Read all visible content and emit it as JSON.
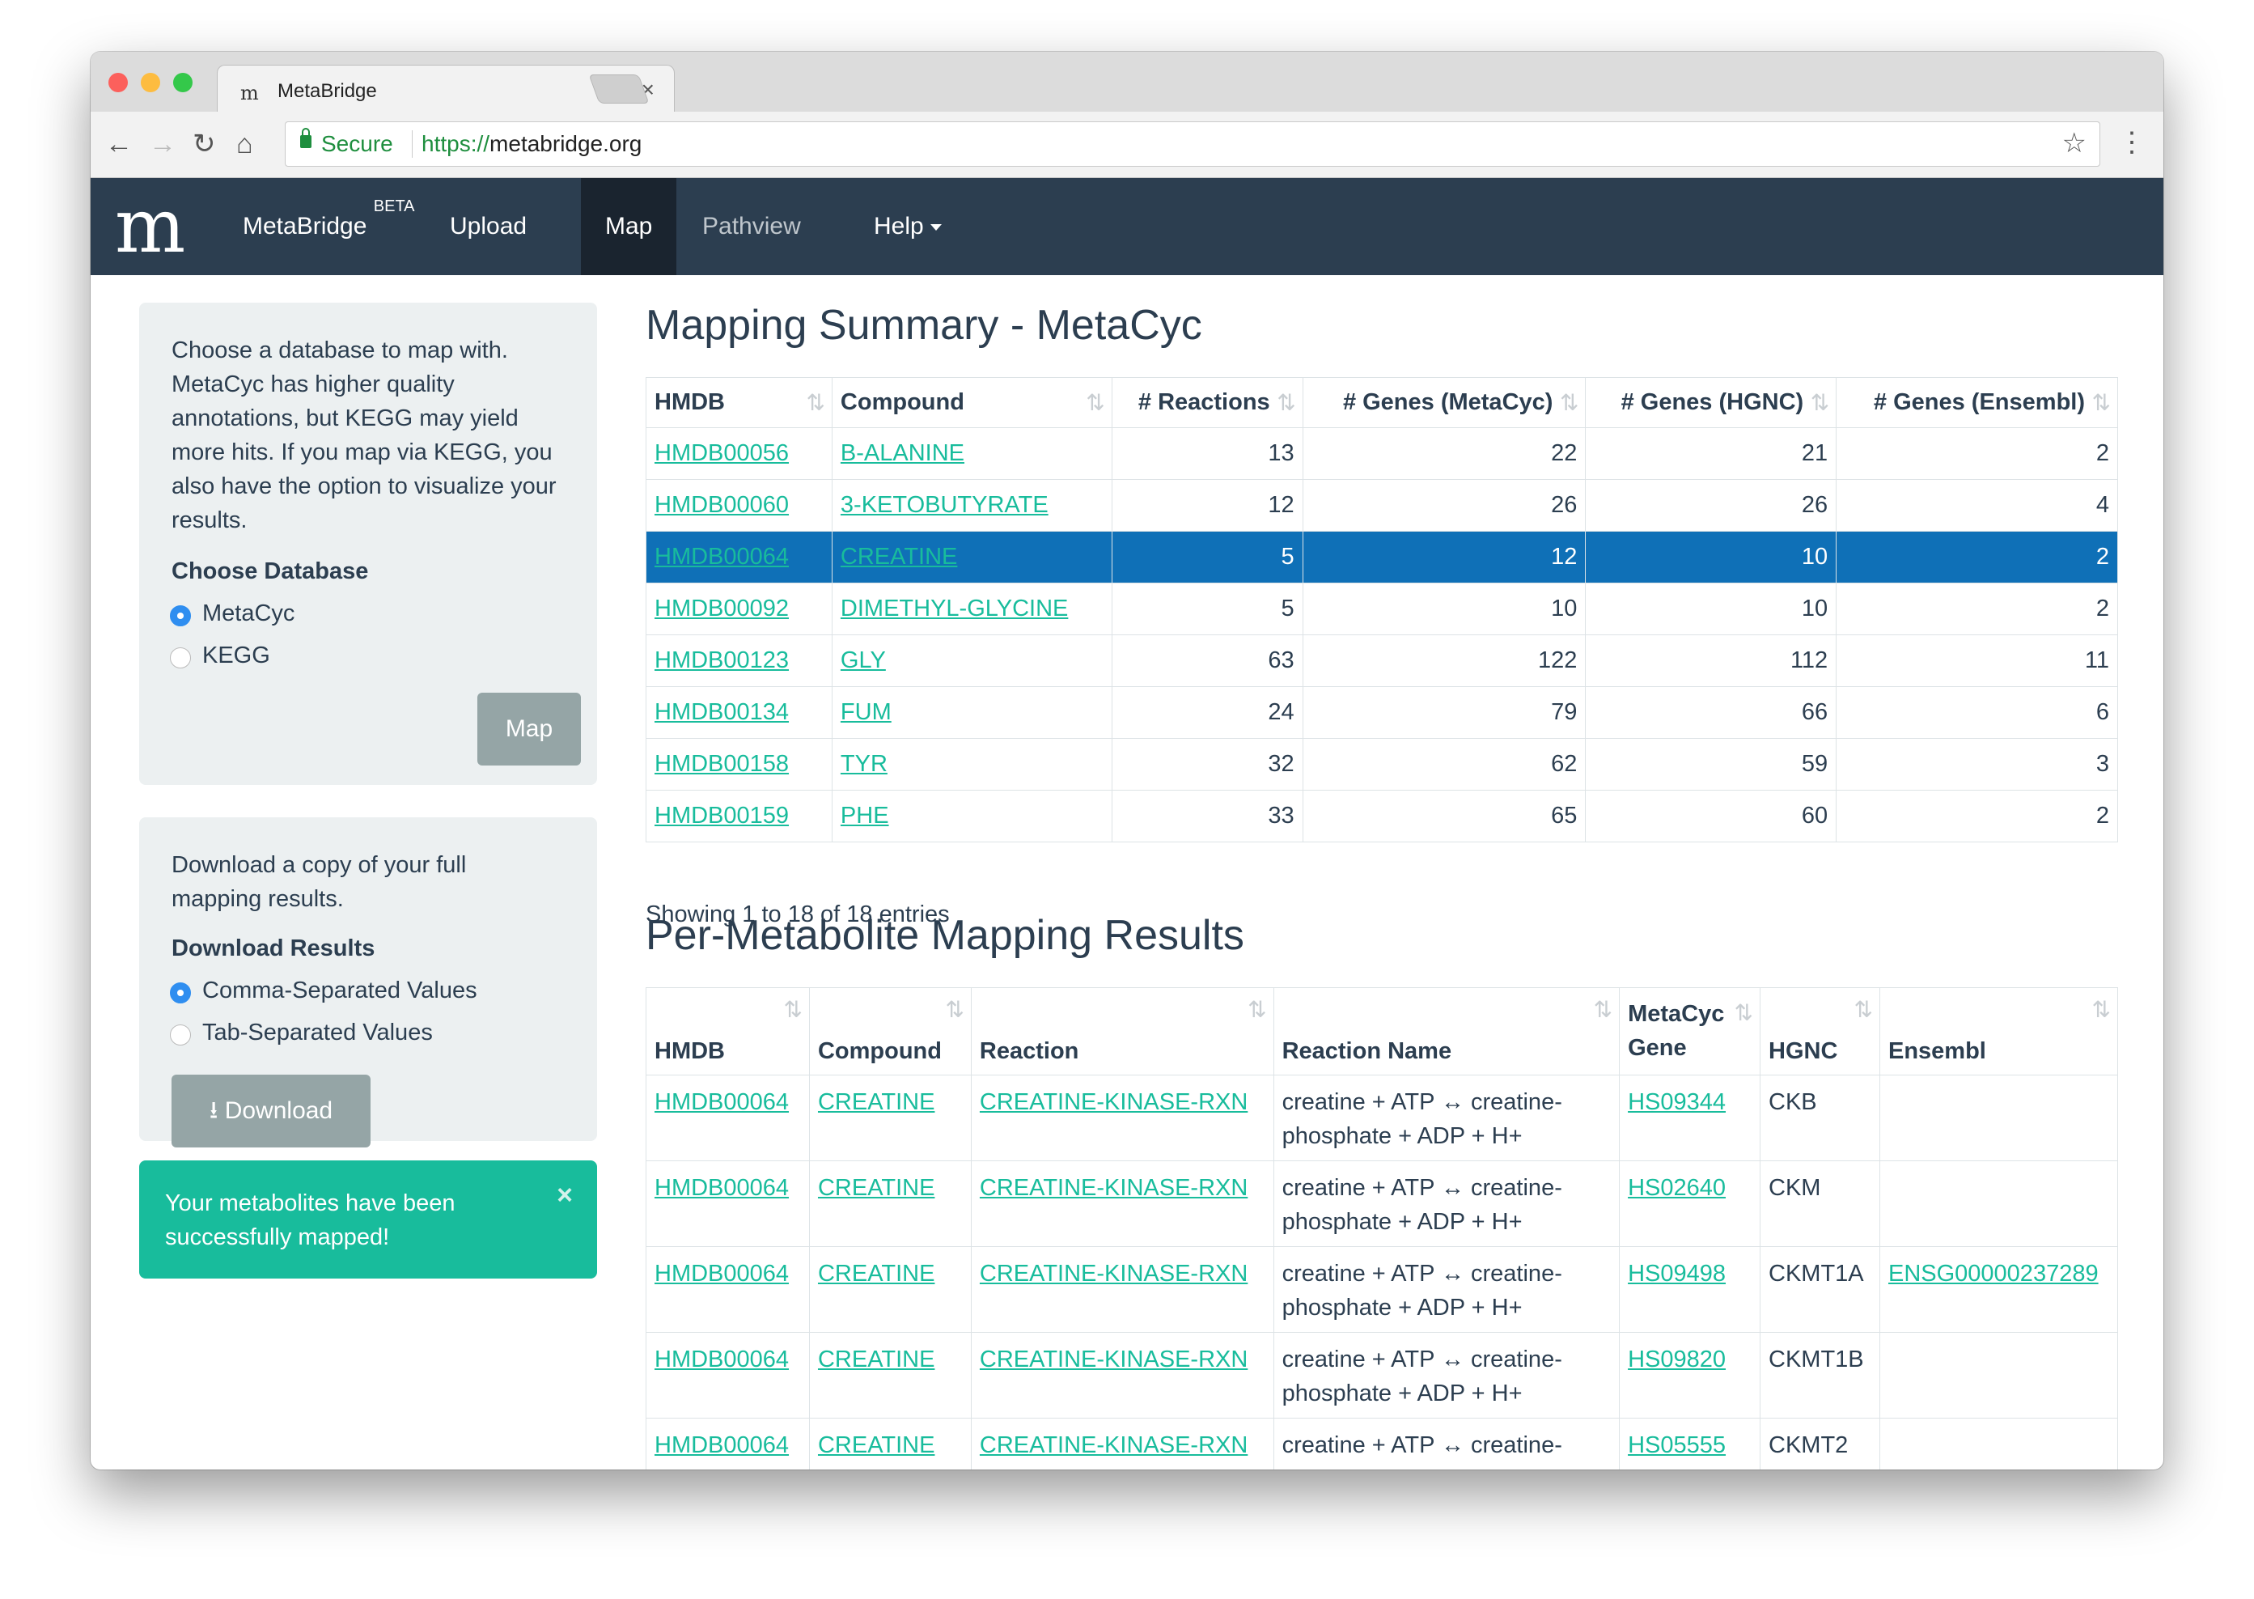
{
  "browser": {
    "tab_title": "MetaBridge",
    "tab_favicon": "m",
    "tab_close": "×",
    "secure_label": "Secure",
    "url_protocol": "https://",
    "url_host": "metabridge.org"
  },
  "navbar": {
    "logo": "m",
    "brand": "MetaBridge",
    "brand_badge": "BETA",
    "items": [
      "Upload",
      "Map",
      "Pathview",
      "Help"
    ],
    "active": "Map"
  },
  "sidebar": {
    "map_panel": {
      "description": "Choose a database to map with. MetaCyc has higher quality annotations, but KEGG may yield more hits. If you map via KEGG, you also have the option to visualize your results.",
      "label": "Choose Database",
      "options": [
        "MetaCyc",
        "KEGG"
      ],
      "selected": "MetaCyc",
      "button": "Map"
    },
    "download_panel": {
      "description": "Download a copy of your full mapping results.",
      "label": "Download Results",
      "options": [
        "Comma-Separated Values",
        "Tab-Separated Values"
      ],
      "selected": "Comma-Separated Values",
      "button": "Download"
    },
    "alert": {
      "message": "Your metabolites have been successfully mapped!",
      "close": "×"
    }
  },
  "summary": {
    "title": "Mapping Summary - MetaCyc",
    "columns": [
      "HMDB",
      "Compound",
      "# Reactions",
      "# Genes (MetaCyc)",
      "# Genes (HGNC)",
      "# Genes (Ensembl)"
    ],
    "rows": [
      [
        "HMDB00056",
        "B-ALANINE",
        "13",
        "22",
        "21",
        "2"
      ],
      [
        "HMDB00060",
        "3-KETOBUTYRATE",
        "12",
        "26",
        "26",
        "4"
      ],
      [
        "HMDB00064",
        "CREATINE",
        "5",
        "12",
        "10",
        "2"
      ],
      [
        "HMDB00092",
        "DIMETHYL-GLYCINE",
        "5",
        "10",
        "10",
        "2"
      ],
      [
        "HMDB00123",
        "GLY",
        "63",
        "122",
        "112",
        "11"
      ],
      [
        "HMDB00134",
        "FUM",
        "24",
        "79",
        "66",
        "6"
      ],
      [
        "HMDB00158",
        "TYR",
        "32",
        "62",
        "59",
        "3"
      ],
      [
        "HMDB00159",
        "PHE",
        "33",
        "65",
        "60",
        "2"
      ]
    ],
    "selected_row": "HMDB00064",
    "info": "Showing 1 to 18 of 18 entries"
  },
  "per_metabolite": {
    "title": "Per-Metabolite Mapping Results",
    "columns": [
      "HMDB",
      "Compound",
      "Reaction",
      "Reaction Name",
      "MetaCyc Gene",
      "HGNC",
      "Ensembl"
    ],
    "rows": [
      [
        "HMDB00064",
        "CREATINE",
        "CREATINE-KINASE-RXN",
        "creatine + ATP ↔ creatine-phosphate + ADP + H+",
        "HS09344",
        "CKB",
        ""
      ],
      [
        "HMDB00064",
        "CREATINE",
        "CREATINE-KINASE-RXN",
        "creatine + ATP ↔ creatine-phosphate + ADP + H+",
        "HS02640",
        "CKM",
        ""
      ],
      [
        "HMDB00064",
        "CREATINE",
        "CREATINE-KINASE-RXN",
        "creatine + ATP ↔ creatine-phosphate + ADP + H+",
        "HS09498",
        "CKMT1A",
        "ENSG00000237289"
      ],
      [
        "HMDB00064",
        "CREATINE",
        "CREATINE-KINASE-RXN",
        "creatine + ATP ↔ creatine-phosphate + ADP + H+",
        "HS09820",
        "CKMT1B",
        ""
      ],
      [
        "HMDB00064",
        "CREATINE",
        "CREATINE-KINASE-RXN",
        "creatine + ATP ↔ creatine-phosphate + ADP + H+",
        "HS05555",
        "CKMT2",
        ""
      ]
    ]
  },
  "colors": {
    "navbar": "#2c3e50",
    "accent": "#18bc9c",
    "selected_row": "#0f70b7",
    "well": "#ecf0f1"
  }
}
